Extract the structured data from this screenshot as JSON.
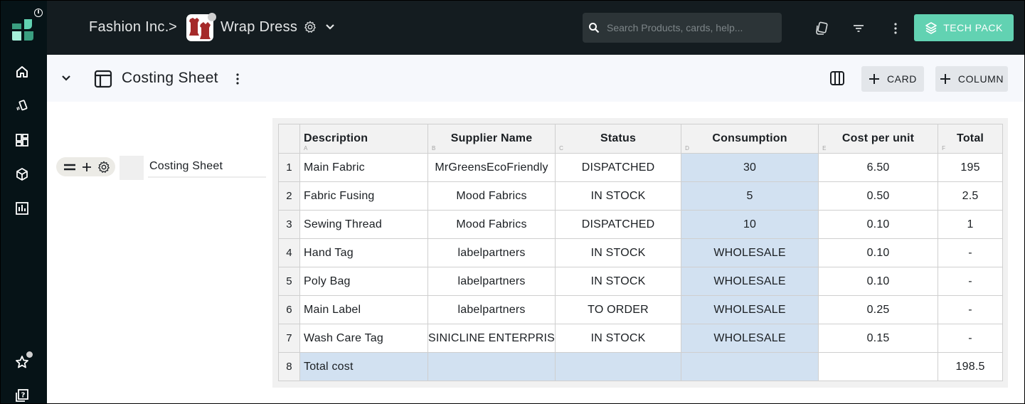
{
  "app": {
    "rail": {
      "items": [
        {
          "name": "home",
          "icon": "home-icon"
        },
        {
          "name": "cards",
          "icon": "cards-icon"
        },
        {
          "name": "dashboard",
          "icon": "dashboard-icon"
        },
        {
          "name": "products",
          "icon": "box-icon"
        },
        {
          "name": "reports",
          "icon": "bar-chart-icon"
        },
        {
          "name": "favorites",
          "icon": "star-icon"
        },
        {
          "name": "help",
          "icon": "help-icon"
        }
      ]
    }
  },
  "header": {
    "org": "Fashion Inc.",
    "separator": ">",
    "product": "Wrap Dress",
    "search_placeholder": "Search Products, cards, help...",
    "tech_pack_label": "TECH PACK",
    "accent_color": "#62d2b2"
  },
  "subheader": {
    "title": "Costing Sheet",
    "card_button": "CARD",
    "column_button": "COLUMN"
  },
  "card": {
    "name": "Costing Sheet"
  },
  "table": {
    "columns": [
      {
        "label": "Description",
        "letter": "A"
      },
      {
        "label": "Supplier Name",
        "letter": "B"
      },
      {
        "label": "Status",
        "letter": "C"
      },
      {
        "label": "Consumption",
        "letter": "D"
      },
      {
        "label": "Cost per unit",
        "letter": "E"
      },
      {
        "label": "Total",
        "letter": "F"
      }
    ],
    "rows": [
      {
        "n": "1",
        "description": "Main Fabric",
        "supplier": "MrGreensEcoFriendly",
        "status": "DISPATCHED",
        "consumption": "30",
        "cost": "6.50",
        "total": "195"
      },
      {
        "n": "2",
        "description": "Fabric Fusing",
        "supplier": "Mood Fabrics",
        "status": "IN STOCK",
        "consumption": "5",
        "cost": "0.50",
        "total": "2.5"
      },
      {
        "n": "3",
        "description": "Sewing Thread",
        "supplier": "Mood Fabrics",
        "status": "DISPATCHED",
        "consumption": "10",
        "cost": "0.10",
        "total": "1"
      },
      {
        "n": "4",
        "description": "Hand Tag",
        "supplier": "labelpartners",
        "status": "IN STOCK",
        "consumption": "WHOLESALE",
        "cost": "0.10",
        "total": "-"
      },
      {
        "n": "5",
        "description": "Poly Bag",
        "supplier": "labelpartners",
        "status": "IN STOCK",
        "consumption": "WHOLESALE",
        "cost": "0.10",
        "total": "-"
      },
      {
        "n": "6",
        "description": "Main Label",
        "supplier": "labelpartners",
        "status": "TO ORDER",
        "consumption": "WHOLESALE",
        "cost": "0.25",
        "total": "-"
      },
      {
        "n": "7",
        "description": "Wash Care Tag",
        "supplier": "SINICLINE ENTERPRIS",
        "status": "IN STOCK",
        "consumption": "WHOLESALE",
        "cost": "0.15",
        "total": "-"
      },
      {
        "n": "8",
        "description": "Total cost",
        "supplier": "",
        "status": "",
        "consumption": "",
        "cost": "",
        "total": "198.5"
      }
    ],
    "highlight_color": "#d2e1f1"
  }
}
